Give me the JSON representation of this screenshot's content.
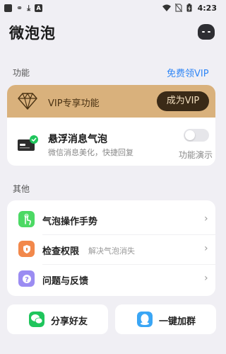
{
  "status_bar": {
    "time": "4:23",
    "left_icons": [
      "app-square-icon",
      "notification-glyph-icon",
      "download-icon",
      "a-badge-icon"
    ],
    "right_icons": [
      "wifi-icon",
      "no-sim-icon",
      "battery-icon"
    ]
  },
  "app": {
    "title": "微泡泡"
  },
  "feature_section": {
    "label": "功能",
    "free_vip_link": "免费领VIP",
    "vip_banner": {
      "label": "VIP专享功能",
      "button": "成为VIP"
    },
    "floating_bubble": {
      "title": "悬浮消息气泡",
      "subtitle": "微信消息美化，快捷回复",
      "toggle_on": false,
      "demo_link": "功能演示"
    }
  },
  "other_section": {
    "label": "其他",
    "items": [
      {
        "title": "气泡操作手势",
        "subtitle": "",
        "icon": "gesture-icon",
        "color": "#4cd964"
      },
      {
        "title": "检查权限",
        "subtitle": "解决气泡消失",
        "icon": "permission-icon",
        "color": "#f2884b"
      },
      {
        "title": "问题与反馈",
        "subtitle": "",
        "icon": "help-icon",
        "color": "#9b8cf2"
      }
    ]
  },
  "bottom_buttons": {
    "share": {
      "label": "分享好友",
      "icon": "wechat-icon",
      "color": "#1fc55c"
    },
    "join": {
      "label": "一键加群",
      "icon": "qq-icon",
      "color": "#3aa6f5"
    }
  },
  "colors": {
    "accent": "#2f86f6",
    "vip_gold": "#d9b17c",
    "vip_button": "#3a2a17",
    "background": "#f0eff4"
  }
}
